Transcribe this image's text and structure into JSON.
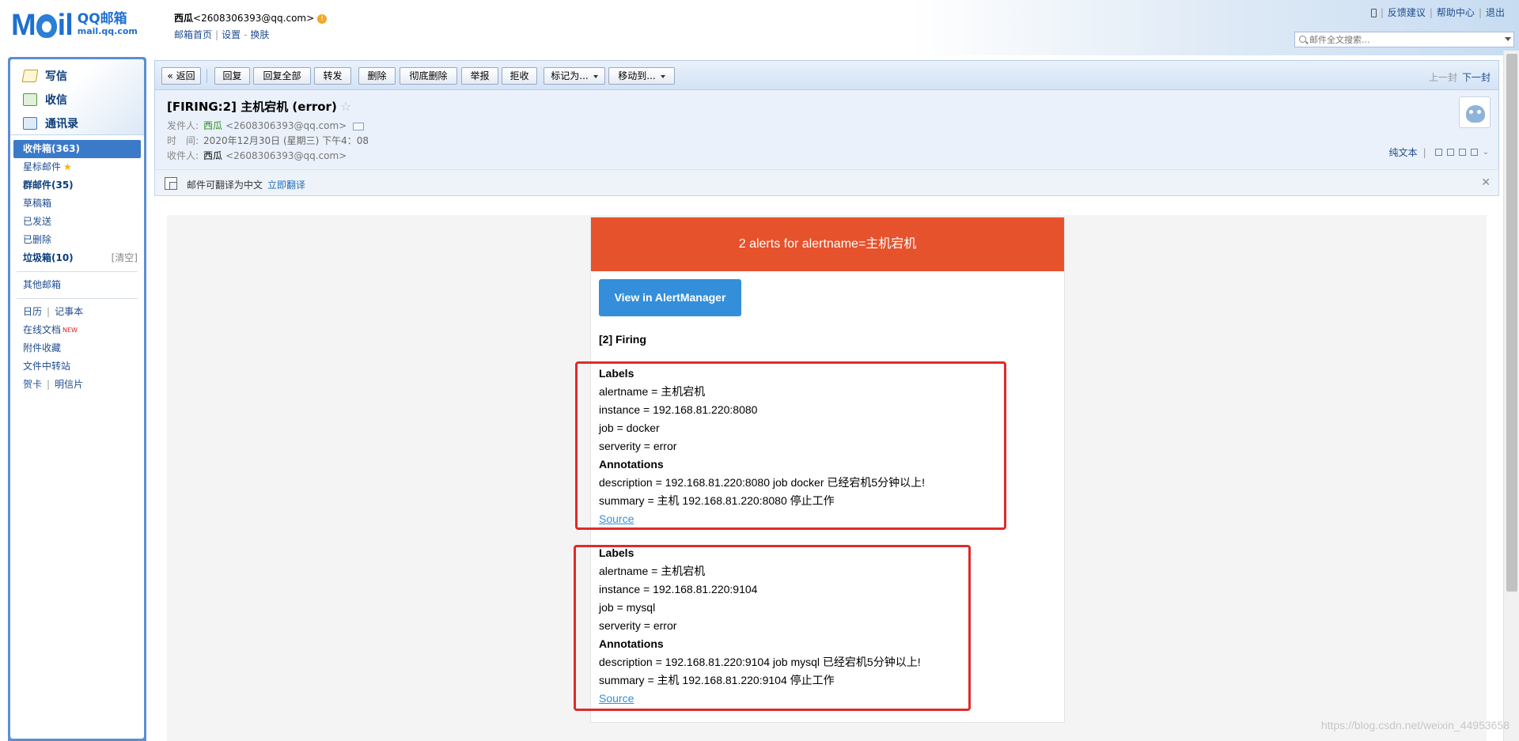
{
  "header": {
    "logo_brand": "MoiL",
    "logo_cn": "QQ邮箱",
    "logo_url": "mail.qq.com",
    "user_name": "西瓜",
    "user_email": "<2608306393@qq.com>",
    "links": [
      "邮箱首页",
      "设置",
      "换肤"
    ],
    "top_links": [
      "反馈建议",
      "帮助中心",
      "退出"
    ],
    "search_placeholder": "邮件全文搜索..."
  },
  "sidebar": {
    "quick": [
      {
        "label": "写信",
        "icon": "pencil-icon"
      },
      {
        "label": "收信",
        "icon": "inbox-download-icon"
      },
      {
        "label": "通讯录",
        "icon": "contacts-icon"
      }
    ],
    "folders": {
      "inbox": "收件箱(363)",
      "starred": "星标邮件",
      "group": "群邮件(35)",
      "drafts": "草稿箱",
      "sent": "已发送",
      "deleted": "已删除",
      "spam": "垃圾箱(10)",
      "spam_clear": "[清空]",
      "other": "其他邮箱",
      "calendar": "日历",
      "notes": "记事本",
      "docs": "在线文档",
      "docs_badge": "NEW",
      "attach": "附件收藏",
      "transfer": "文件中转站",
      "cards": "贺卡",
      "postcard": "明信片"
    }
  },
  "toolbar": {
    "back": "« 返回",
    "reply": "回复",
    "reply_all": "回复全部",
    "forward": "转发",
    "delete": "删除",
    "perm_delete": "彻底删除",
    "report": "举报",
    "reject": "拒收",
    "mark_as": "标记为...",
    "move_to": "移动到...",
    "prev": "上一封",
    "next": "下一封"
  },
  "mail": {
    "subject": "[FIRING:2] 主机宕机 (error)",
    "from_label": "发件人:",
    "from_name": "西瓜",
    "from_addr": "<2608306393@qq.com>",
    "time_label": "时　间:",
    "time_value": "2020年12月30日 (星期三) 下午4：08",
    "to_label": "收件人:",
    "to_name": "西瓜",
    "to_addr": "<2608306393@qq.com>",
    "plain_text": "纯文本"
  },
  "translate": {
    "text": "邮件可翻译为中文",
    "link": "立即翻译"
  },
  "alert": {
    "header": "2 alerts for alertname=主机宕机",
    "button": "View in AlertManager",
    "firing": "[2] Firing",
    "alerts": [
      {
        "labels_title": "Labels",
        "alertname": "alertname = 主机宕机",
        "instance": "instance = 192.168.81.220:8080",
        "job": "job = docker",
        "serverity": "serverity = error",
        "annotations_title": "Annotations",
        "description": "description = 192.168.81.220:8080 job docker 已经宕机5分钟以上!",
        "summary": "summary = 主机 192.168.81.220:8080 停止工作",
        "source": "Source"
      },
      {
        "labels_title": "Labels",
        "alertname": "alertname = 主机宕机",
        "instance": "instance = 192.168.81.220:9104",
        "job": "job = mysql",
        "serverity": "serverity = error",
        "annotations_title": "Annotations",
        "description": "description = 192.168.81.220:9104 job mysql 已经宕机5分钟以上!",
        "summary": "summary = 主机 192.168.81.220:9104 停止工作",
        "source": "Source"
      }
    ]
  },
  "watermark": "https://blog.csdn.net/weixin_44953658",
  "colors": {
    "alert_header": "#e6522c",
    "am_button": "#348eda",
    "highlight_box": "#e02a2a",
    "sidebar_frame": "#5b8fd0"
  }
}
